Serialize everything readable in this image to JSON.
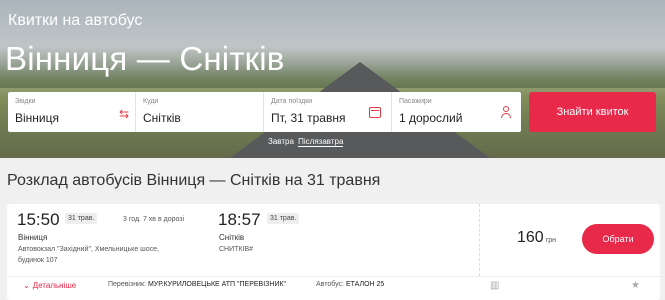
{
  "hero": {
    "eyebrow": "Квитки на автобус",
    "title": "Вінниця — Снітків"
  },
  "search": {
    "from_label": "Звідки",
    "from_value": "Вінниця",
    "to_label": "Куди",
    "to_value": "Снітків",
    "date_label": "Дата поїздки",
    "date_value": "Пт, 31 травня",
    "passengers_label": "Пасажири",
    "passengers_value": "1 дорослий",
    "find_button": "Знайти квиток"
  },
  "quick_dates": {
    "tomorrow": "Завтра",
    "day_after": "Післязавтра"
  },
  "schedule": {
    "title": "Розклад автобусів Вінниця — Снітків на 31 травня"
  },
  "trip": {
    "depart_time": "15:50",
    "depart_date": "31 трав.",
    "duration": "3 год. 7 хв в дорозі",
    "arrive_time": "18:57",
    "arrive_date": "31 трав.",
    "depart_city": "Вінниця",
    "depart_addr_1": "Автовокзал \"Західний\", Хмельницьке шосе,",
    "depart_addr_2": "будинок 107",
    "arrive_city": "Снітків",
    "arrive_addr": "СНИТКІВ#",
    "price": "160",
    "currency": "грн",
    "choose_button": "Обрати",
    "details_link": "Детальніше",
    "carrier_label": "Перевізник:",
    "carrier_value": "МУР.КУРИЛОВЕЦЬКЕ АТП \"ПЕРЕВІЗНИК\"",
    "bus_label": "Автобус:",
    "bus_value": "ЕТАЛОН 25"
  },
  "colors": {
    "accent": "#e8294a"
  }
}
